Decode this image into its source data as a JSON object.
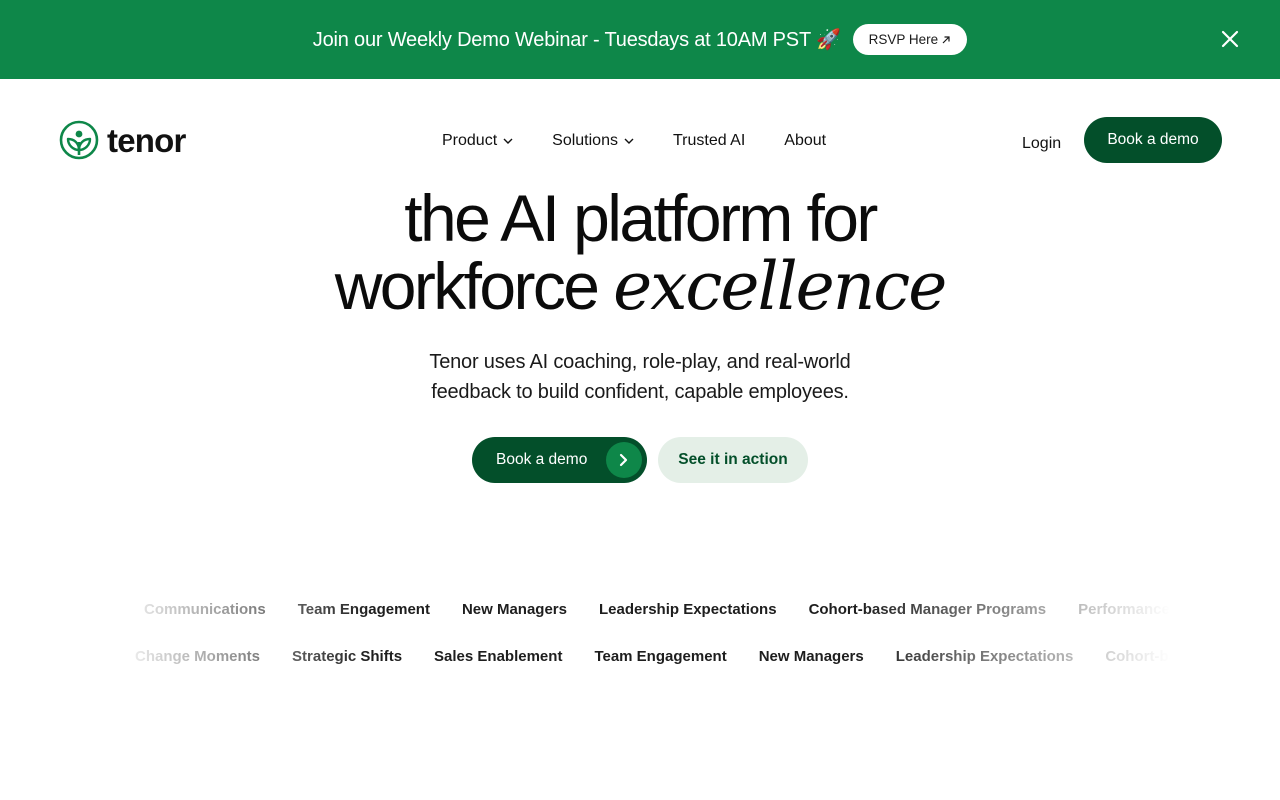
{
  "banner": {
    "text": "Join our Weekly Demo Webinar - Tuesdays at 10AM PST 🚀",
    "rsvp_label": "RSVP Here",
    "rsvp_icon": "arrow-up-right-icon",
    "close_icon": "close-icon",
    "bg_color": "#0e8749"
  },
  "header": {
    "logo_text": "tenor",
    "nav": [
      {
        "label": "Product",
        "has_dropdown": true
      },
      {
        "label": "Solutions",
        "has_dropdown": true
      },
      {
        "label": "Trusted AI",
        "has_dropdown": false
      },
      {
        "label": "About",
        "has_dropdown": false
      }
    ],
    "login_label": "Login",
    "cta_label": "Book a demo"
  },
  "hero": {
    "headline_line1": "the AI platform for",
    "headline_line2_plain": "workforce ",
    "headline_line2_accent": "excellence",
    "subtitle_line1": "Tenor uses AI coaching, role-play, and real-world",
    "subtitle_line2": "feedback to build confident, capable employees.",
    "primary_cta": "Book a demo",
    "primary_cta_icon": "chevron-right-icon",
    "secondary_cta": "See it in action"
  },
  "marquee": {
    "row1": [
      "Communications",
      "Team Engagement",
      "New Managers",
      "Leadership Expectations",
      "Cohort-based Manager Programs",
      "Performance"
    ],
    "row2": [
      "Change Moments",
      "Strategic Shifts",
      "Sales Enablement",
      "Team Engagement",
      "New Managers",
      "Leadership Expectations",
      "Cohort-based Manager Programs"
    ]
  },
  "colors": {
    "brand_dark": "#034f2a",
    "brand_green": "#0e8749",
    "secondary_bg": "#e4efe7"
  }
}
